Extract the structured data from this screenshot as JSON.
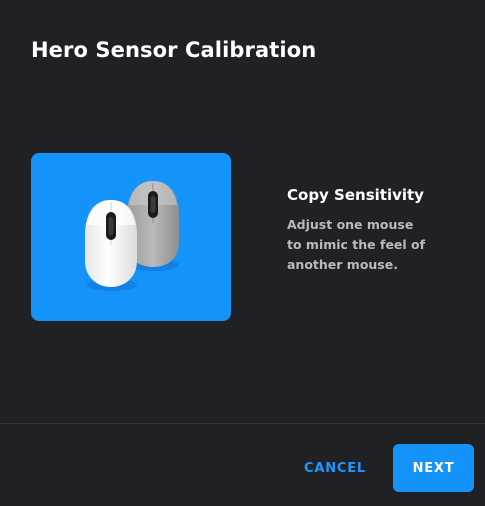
{
  "dialog": {
    "title": "Hero Sensor Calibration"
  },
  "feature": {
    "title": "Copy Sensitivity",
    "description": "Adjust one mouse to mimic the feel of another mouse.",
    "illustration": "two-mice-illustration"
  },
  "actions": {
    "cancel_label": "CANCEL",
    "next_label": "NEXT"
  },
  "colors": {
    "background": "#202124",
    "accent": "#1493fb",
    "text_primary": "#ffffff",
    "text_secondary": "#b9babd"
  }
}
